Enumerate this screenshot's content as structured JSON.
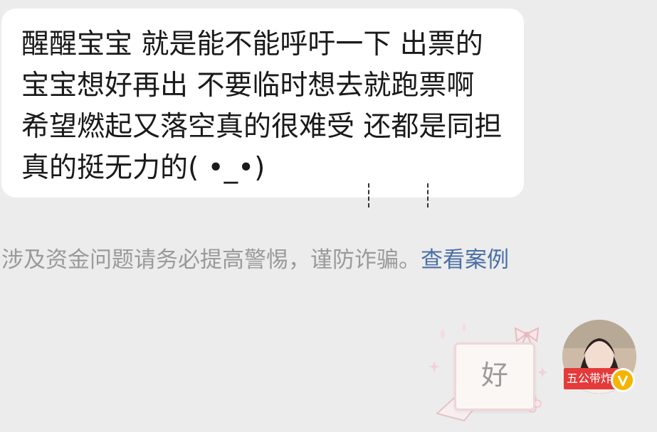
{
  "message": {
    "text": "醒醒宝宝 就是能不能呼吁一下 出票的宝宝想好再出 不要临时想去就跑票啊 希望燃起又落空真的很难受 还都是同担 真的挺无力的( •_•)"
  },
  "system_notice": {
    "text": "涉及资金问题请务必提高警惕，谨防诈骗。",
    "link_label": "查看案例"
  },
  "sticker": {
    "text": "好"
  },
  "avatar": {
    "banner_text": "五公带炸",
    "badge_letter": "V"
  },
  "colors": {
    "background": "#ececec",
    "bubble": "#ffffff",
    "link": "#4a6fa5",
    "notice": "#9a9a9a",
    "banner": "#e43a3a",
    "badge": "#f5b400"
  }
}
